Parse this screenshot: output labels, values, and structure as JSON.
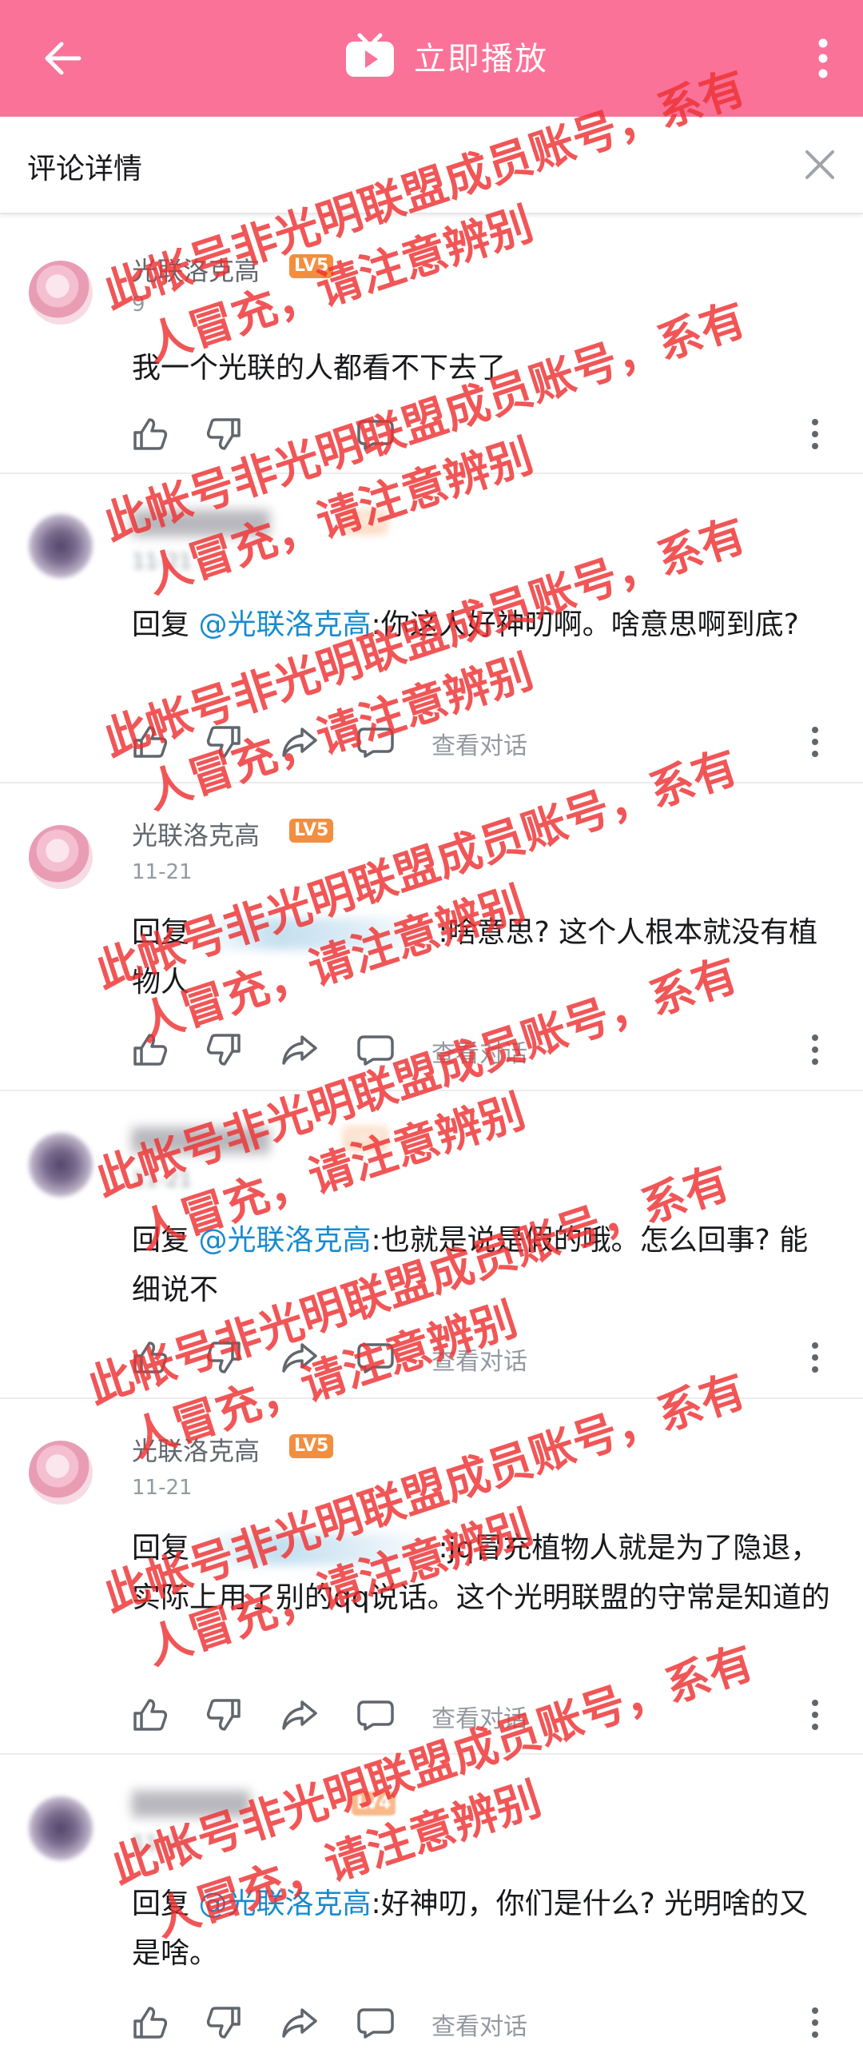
{
  "topbar": {
    "play_label": "立即播放"
  },
  "header": {
    "title": "评论详情"
  },
  "watermark": {
    "line1": "此帐号非光明联盟成员账号，系有",
    "line2": "人冒充，请注意辨别"
  },
  "comments": [
    {
      "user": "光联洛克高",
      "level": "LV5",
      "date": "9",
      "text": "我一个光联的人都看不下去了",
      "view_conversation": ""
    },
    {
      "user": "",
      "level": "LV4",
      "date": "11-21",
      "reply_prefix": "回复 ",
      "mention": "@光联洛克高",
      "text": ":你这人好神叨啊。啥意思啊到底?",
      "view_conversation": "查看对话"
    },
    {
      "user": "光联洛克高",
      "level": "LV5",
      "date": "11-21",
      "reply_prefix": "回复 ",
      "text": ":啥意思? 这个人根本就没有植物人",
      "view_conversation": "查看对话"
    },
    {
      "user": "",
      "level": "LV4",
      "date": "11-21",
      "reply_prefix": "回复 ",
      "mention": "@光联洛克高",
      "text": ":也就是说是假的哦。怎么回事? 能细说不",
      "view_conversation": "查看对话"
    },
    {
      "user": "光联洛克高",
      "level": "LV5",
      "date": "11-21",
      "reply_prefix": "回复 ",
      "text": ":jq冒充植物人就是为了隐退，实际上用了别的qq说话。这个光明联盟的守常是知道的",
      "view_conversation": "查看对话"
    },
    {
      "user": "",
      "level": "LV4",
      "date": "11-21",
      "reply_prefix": "回复 ",
      "mention": "@光联洛克高",
      "text": ":好神叨，你们是什么? 光明啥的又是啥。",
      "view_conversation": "查看对话"
    }
  ]
}
